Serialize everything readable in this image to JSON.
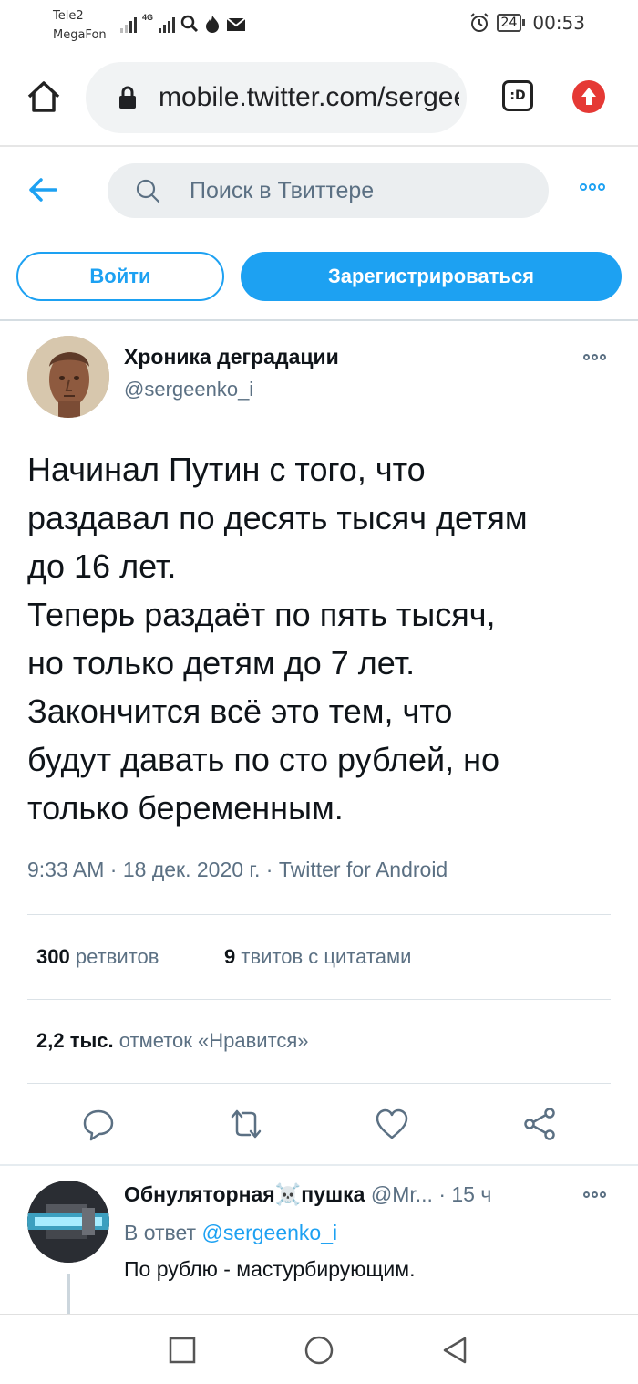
{
  "status_bar": {
    "carrier1": "Tele2",
    "carrier2": "MegaFon",
    "network_label": "4G",
    "battery": "24",
    "time": "00:53",
    "icons": [
      "signal-icon",
      "search-icon",
      "fire-icon",
      "mail-icon",
      "alarm-icon",
      "battery-icon"
    ]
  },
  "browser": {
    "url": "mobile.twitter.com/sergeenko_i",
    "tabs_label": ":D"
  },
  "twitter_header": {
    "search_placeholder": "Поиск в Твиттере"
  },
  "auth": {
    "login_label": "Войти",
    "signup_label": "Зарегистрироваться"
  },
  "tweet": {
    "author_name": "Хроника деградации",
    "author_handle": "@sergeenko_i",
    "text": "Начинал Путин с того, что\nраздавал по десять тысяч детям\nдо 16 лет.\nТеперь раздаёт по пять тысяч,\nно только детям до 7 лет.\nЗакончится всё это тем, что\nбудут давать по сто рублей, но\nтолько беременным.",
    "time": "9:33 AM",
    "date": "18 дек. 2020 г.",
    "source": "Twitter for Android",
    "retweets_count": "300",
    "retweets_label": "ретвитов",
    "quotes_count": "9",
    "quotes_label": "твитов с цитатами",
    "likes_count": "2,2 тыс.",
    "likes_label": "отметок «Нравится»"
  },
  "reply": {
    "author_name": "Обнуляторная☠️пушка",
    "author_handle": "@Mr...",
    "time_ago": "15 ч",
    "reply_to_prefix": "В ответ",
    "reply_to_handle": "@sergeenko_i",
    "text": "По рублю - мастурбирующим."
  },
  "colors": {
    "accent": "#1da1f2",
    "muted": "#5b7083",
    "text": "#0f1419"
  }
}
